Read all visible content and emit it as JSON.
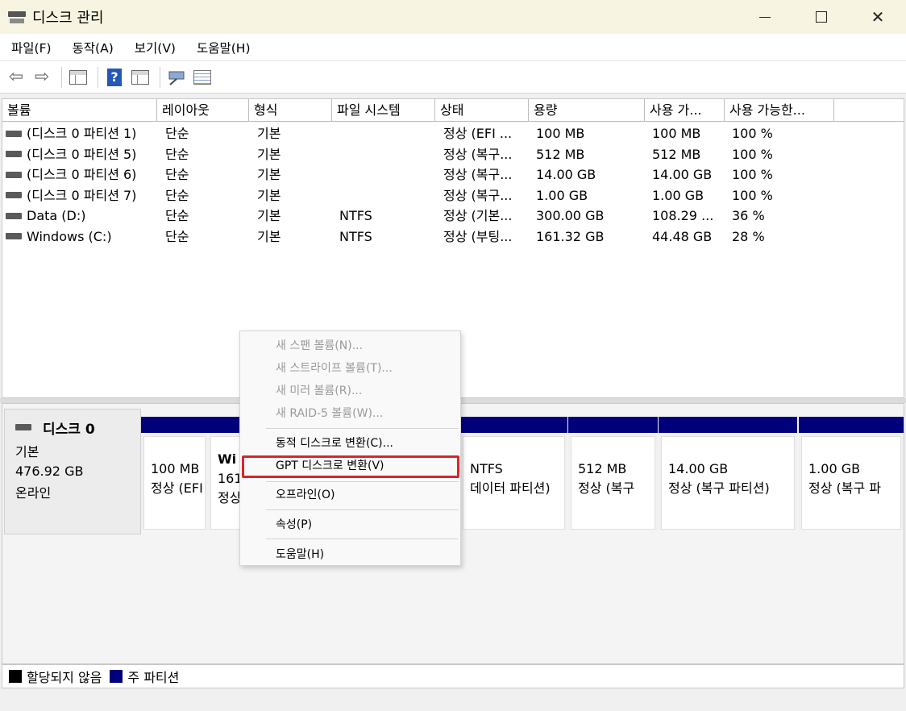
{
  "window": {
    "title": "디스크 관리",
    "minimize": "—",
    "maximize": "□",
    "close": "✕"
  },
  "menu": [
    "파일(F)",
    "동작(A)",
    "보기(V)",
    "도움말(H)"
  ],
  "toolbar": {
    "back": "⇦",
    "forward": "⇨",
    "help": "?"
  },
  "volumes": {
    "columns": [
      "볼륨",
      "레이아웃",
      "형식",
      "파일 시스템",
      "상태",
      "용량",
      "사용 가...",
      "사용 가능한..."
    ],
    "rows": [
      [
        "(디스크 0 파티션 1)",
        "단순",
        "기본",
        "",
        "정상 (EFI ...",
        "100 MB",
        "100 MB",
        "100 %"
      ],
      [
        "(디스크 0 파티션 5)",
        "단순",
        "기본",
        "",
        "정상 (복구...",
        "512 MB",
        "512 MB",
        "100 %"
      ],
      [
        "(디스크 0 파티션 6)",
        "단순",
        "기본",
        "",
        "정상 (복구...",
        "14.00 GB",
        "14.00 GB",
        "100 %"
      ],
      [
        "(디스크 0 파티션 7)",
        "단순",
        "기본",
        "",
        "정상 (복구...",
        "1.00 GB",
        "1.00 GB",
        "100 %"
      ],
      [
        "Data (D:)",
        "단순",
        "기본",
        "NTFS",
        "정상 (기본...",
        "300.00 GB",
        "108.29 ...",
        "36 %"
      ],
      [
        "Windows (C:)",
        "단순",
        "기본",
        "NTFS",
        "정상 (부팅...",
        "161.32 GB",
        "44.48 GB",
        "28 %"
      ]
    ]
  },
  "disk": {
    "name": "디스크 0",
    "type": "기본",
    "size": "476.92 GB",
    "status": "온라인",
    "partitions": [
      {
        "line1": "",
        "line2": "100 MB",
        "line3": "정상 (EFI"
      },
      {
        "line1": "Wi",
        "line2": "161",
        "line3": "정상"
      },
      {
        "line1": "",
        "line2": "NTFS",
        "line3": "데이터 파티션)"
      },
      {
        "line1": "",
        "line2": "512 MB",
        "line3": "정상 (복구"
      },
      {
        "line1": "",
        "line2": "14.00 GB",
        "line3": "정상 (복구 파티션)"
      },
      {
        "line1": "",
        "line2": "1.00 GB",
        "line3": "정상 (복구 파"
      }
    ]
  },
  "legend": {
    "unallocated": "할당되지 않음",
    "primary": "주 파티션",
    "unallocated_color": "#000000",
    "primary_color": "#00007b"
  },
  "context_menu": {
    "items": [
      {
        "label": "새 스팬 볼륨(N)...",
        "disabled": true
      },
      {
        "label": "새 스트라이프 볼륨(T)...",
        "disabled": true
      },
      {
        "label": "새 미러 볼륨(R)...",
        "disabled": true
      },
      {
        "label": "새 RAID-5 볼륨(W)...",
        "disabled": true
      },
      {
        "label": "동적 디스크로 변환(C)...",
        "disabled": false
      },
      {
        "label": "GPT 디스크로 변환(V)",
        "disabled": false,
        "highlighted": true
      },
      {
        "label": "오프라인(O)",
        "disabled": false
      },
      {
        "label": "속성(P)",
        "disabled": false
      },
      {
        "label": "도움말(H)",
        "disabled": false
      }
    ],
    "highlight_color": "#d9252b"
  }
}
